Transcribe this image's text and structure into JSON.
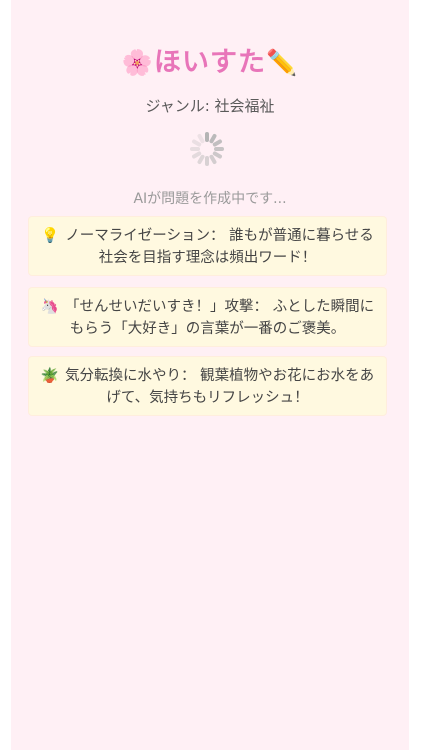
{
  "header": {
    "title_icon_left": "🌸",
    "title": "ほいすた",
    "title_icon_right": "✏️",
    "genre": "ジャンル: 社会福祉"
  },
  "loading": {
    "status": "AIが問題を作成中です..."
  },
  "tips": [
    {
      "icon": "💡",
      "title": "ノーマライゼーション：",
      "text": "誰もが普通に暮らせる社会を目指す理念は頻出ワード！"
    },
    {
      "icon": "🦄",
      "title": "「せんせいだいすき！」攻撃：",
      "text": "ふとした瞬間にもらう「大好き」の言葉が一番のご褒美。"
    },
    {
      "icon": "🪴",
      "title": "気分転換に水やり：",
      "text": "観葉植物やお花にお水をあげて、気持ちもリフレッシュ！"
    }
  ],
  "colors": {
    "background": "#fff0f5",
    "title": "#e875b9",
    "tip_background": "#fff9e0",
    "spinner": "#b5b5b5"
  }
}
